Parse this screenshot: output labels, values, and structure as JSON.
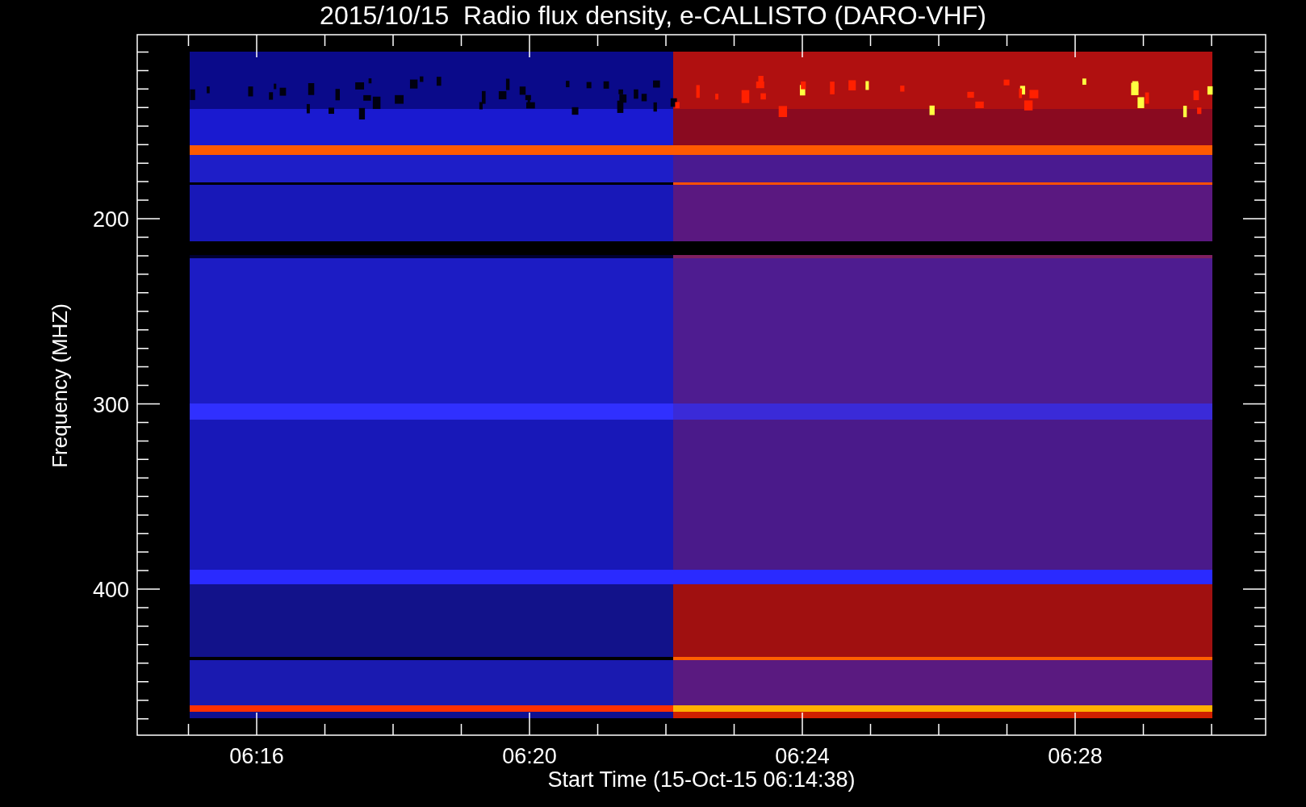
{
  "title": "2015/10/15  Radio flux density, e-CALLISTO (DARO-VHF)",
  "y_axis": {
    "label": "Frequency (MHZ)",
    "ticks": [
      "200",
      "300",
      "400"
    ]
  },
  "x_axis": {
    "label": "Start Time (15-Oct-15 06:14:38)",
    "ticks": [
      "06:16",
      "06:20",
      "06:24",
      "06:28"
    ]
  }
}
